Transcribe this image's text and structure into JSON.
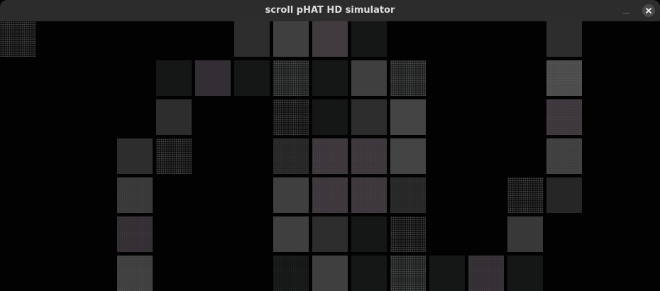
{
  "window": {
    "title": "scroll pHAT HD simulator",
    "controls": {
      "minimize_icon": "minimize-icon",
      "close_icon": "close-icon"
    },
    "colors": {
      "titlebar": "#2c2c2c",
      "title_text": "#dedede",
      "display_background": "#020202"
    }
  },
  "display": {
    "description_columns": 17,
    "description_rows": 7,
    "shades": {
      "speck_dark": "#0e0e0e",
      "very_dark": "#151716",
      "dark": "#1c1e1d",
      "dark_mid": "#262626",
      "mid": "#2d2d2d",
      "mid_light": "#383838",
      "light": "#3f3f3f",
      "light_2": "#444444",
      "lightest": "#4c4c4c",
      "purple_dark": "#332e33",
      "purple": "#3d363c",
      "purple_light": "#413b40"
    },
    "pixels": [
      {
        "col": 0,
        "row": 0,
        "shade": "speck_dark",
        "texture": "speck"
      },
      {
        "col": 6,
        "row": 0,
        "shade": "mid",
        "texture": "none"
      },
      {
        "col": 7,
        "row": 0,
        "shade": "light",
        "texture": "none"
      },
      {
        "col": 8,
        "row": 0,
        "shade": "purple_light",
        "texture": "none"
      },
      {
        "col": 9,
        "row": 0,
        "shade": "very_dark",
        "texture": "none"
      },
      {
        "col": 14,
        "row": 0,
        "shade": "mid",
        "texture": "none"
      },
      {
        "col": 4,
        "row": 1,
        "shade": "very_dark",
        "texture": "none"
      },
      {
        "col": 5,
        "row": 1,
        "shade": "purple_dark",
        "texture": "none"
      },
      {
        "col": 6,
        "row": 1,
        "shade": "very_dark",
        "texture": "none"
      },
      {
        "col": 7,
        "row": 1,
        "shade": "dark",
        "texture": "speck"
      },
      {
        "col": 8,
        "row": 1,
        "shade": "very_dark",
        "texture": "none"
      },
      {
        "col": 9,
        "row": 1,
        "shade": "light",
        "texture": "none"
      },
      {
        "col": 10,
        "row": 1,
        "shade": "dark",
        "texture": "speck"
      },
      {
        "col": 14,
        "row": 1,
        "shade": "lightest",
        "texture": "noise"
      },
      {
        "col": 4,
        "row": 2,
        "shade": "mid",
        "texture": "none"
      },
      {
        "col": 7,
        "row": 2,
        "shade": "speck_dark",
        "texture": "speck"
      },
      {
        "col": 8,
        "row": 2,
        "shade": "very_dark",
        "texture": "none"
      },
      {
        "col": 9,
        "row": 2,
        "shade": "mid",
        "texture": "none"
      },
      {
        "col": 10,
        "row": 2,
        "shade": "light_2",
        "texture": "none"
      },
      {
        "col": 14,
        "row": 2,
        "shade": "purple",
        "texture": "noise"
      },
      {
        "col": 3,
        "row": 3,
        "shade": "mid",
        "texture": "none"
      },
      {
        "col": 4,
        "row": 3,
        "shade": "speck_dark",
        "texture": "speck"
      },
      {
        "col": 7,
        "row": 3,
        "shade": "dark_mid",
        "texture": "noise"
      },
      {
        "col": 8,
        "row": 3,
        "shade": "purple",
        "texture": "noise"
      },
      {
        "col": 9,
        "row": 3,
        "shade": "purple",
        "texture": "noise"
      },
      {
        "col": 10,
        "row": 3,
        "shade": "light_2",
        "texture": "none"
      },
      {
        "col": 14,
        "row": 3,
        "shade": "light",
        "texture": "noise"
      },
      {
        "col": 3,
        "row": 4,
        "shade": "mid_light",
        "texture": "noise"
      },
      {
        "col": 7,
        "row": 4,
        "shade": "light",
        "texture": "none"
      },
      {
        "col": 8,
        "row": 4,
        "shade": "purple",
        "texture": "noise"
      },
      {
        "col": 9,
        "row": 4,
        "shade": "purple",
        "texture": "noise"
      },
      {
        "col": 10,
        "row": 4,
        "shade": "dark_mid",
        "texture": "noise"
      },
      {
        "col": 13,
        "row": 4,
        "shade": "speck_dark",
        "texture": "speck"
      },
      {
        "col": 14,
        "row": 4,
        "shade": "dark_mid",
        "texture": "none"
      },
      {
        "col": 3,
        "row": 5,
        "shade": "purple_dark",
        "texture": "noise"
      },
      {
        "col": 7,
        "row": 5,
        "shade": "light",
        "texture": "none"
      },
      {
        "col": 8,
        "row": 5,
        "shade": "mid",
        "texture": "none"
      },
      {
        "col": 9,
        "row": 5,
        "shade": "very_dark",
        "texture": "none"
      },
      {
        "col": 10,
        "row": 5,
        "shade": "speck_dark",
        "texture": "speck"
      },
      {
        "col": 13,
        "row": 5,
        "shade": "mid_light",
        "texture": "none"
      },
      {
        "col": 3,
        "row": 6,
        "shade": "light",
        "texture": "noise"
      },
      {
        "col": 7,
        "row": 6,
        "shade": "very_dark",
        "texture": "noise"
      },
      {
        "col": 8,
        "row": 6,
        "shade": "light",
        "texture": "none"
      },
      {
        "col": 9,
        "row": 6,
        "shade": "very_dark",
        "texture": "none"
      },
      {
        "col": 10,
        "row": 6,
        "shade": "dark",
        "texture": "speck"
      },
      {
        "col": 11,
        "row": 6,
        "shade": "very_dark",
        "texture": "none"
      },
      {
        "col": 12,
        "row": 6,
        "shade": "purple_dark",
        "texture": "noise"
      },
      {
        "col": 13,
        "row": 6,
        "shade": "very_dark",
        "texture": "none"
      }
    ]
  }
}
